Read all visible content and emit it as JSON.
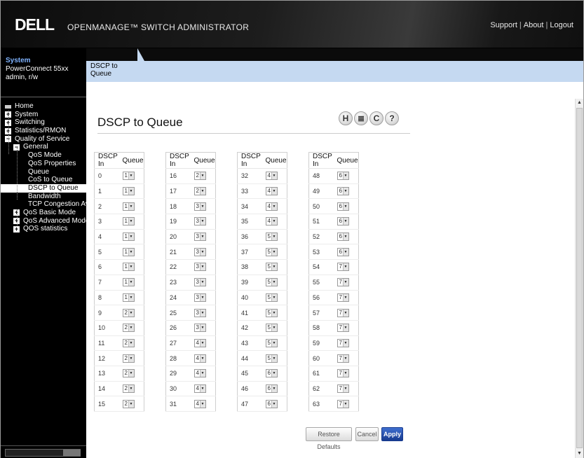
{
  "header": {
    "logo": "DELL",
    "title": "OPENMANAGE™ SWITCH ADMINISTRATOR",
    "links": [
      "Support",
      "About",
      "Logout"
    ]
  },
  "sidebar": {
    "system_title": "System",
    "device": "PowerConnect 55xx",
    "user": "admin, r/w",
    "items": [
      {
        "label": "Home",
        "level": 0,
        "icon": "home-icon"
      },
      {
        "label": "System",
        "level": 0,
        "icon": "expand-icon"
      },
      {
        "label": "Switching",
        "level": 0,
        "icon": "expand-icon"
      },
      {
        "label": "Statistics/RMON",
        "level": 0,
        "icon": "expand-icon"
      },
      {
        "label": "Quality of Service",
        "level": 0,
        "icon": "collapse-icon"
      },
      {
        "label": "General",
        "level": 1,
        "icon": "collapse-icon"
      },
      {
        "label": "QoS Mode",
        "level": 2
      },
      {
        "label": "QoS Properties",
        "level": 2
      },
      {
        "label": "Queue",
        "level": 2
      },
      {
        "label": "CoS to Queue",
        "level": 2
      },
      {
        "label": "DSCP to Queue",
        "level": 2,
        "selected": true
      },
      {
        "label": "Bandwidth",
        "level": 2
      },
      {
        "label": "TCP Congestion Avoi",
        "level": 2
      },
      {
        "label": "QoS Basic Mode",
        "level": 1,
        "icon": "expand-icon"
      },
      {
        "label": "QoS Advanced Mode",
        "level": 1,
        "icon": "expand-icon"
      },
      {
        "label": "QOS statistics",
        "level": 1,
        "icon": "expand-icon"
      }
    ]
  },
  "tab": {
    "label": "DSCP to Queue"
  },
  "page": {
    "title": "DSCP to Queue",
    "tools": [
      {
        "name": "save-icon",
        "glyph": "H"
      },
      {
        "name": "print-icon",
        "glyph": "≣"
      },
      {
        "name": "refresh-icon",
        "glyph": "C"
      },
      {
        "name": "help-icon",
        "glyph": "?"
      }
    ]
  },
  "table": {
    "headers": {
      "dscp": "DSCP In",
      "queue": "Queue"
    },
    "columns": [
      {
        "dscp": [
          "0",
          "1",
          "2",
          "3",
          "4",
          "5",
          "6",
          "7",
          "8",
          "9",
          "10",
          "11",
          "12",
          "13",
          "14",
          "15"
        ],
        "queue": [
          "1",
          "1",
          "1",
          "1",
          "1",
          "1",
          "1",
          "1",
          "1",
          "2",
          "2",
          "2",
          "2",
          "2",
          "2",
          "2"
        ]
      },
      {
        "dscp": [
          "16",
          "17",
          "18",
          "19",
          "20",
          "21",
          "22",
          "23",
          "24",
          "25",
          "26",
          "27",
          "28",
          "29",
          "30",
          "31"
        ],
        "queue": [
          "2",
          "2",
          "3",
          "3",
          "3",
          "3",
          "3",
          "3",
          "3",
          "3",
          "3",
          "4",
          "4",
          "4",
          "4",
          "4"
        ]
      },
      {
        "dscp": [
          "32",
          "33",
          "34",
          "35",
          "36",
          "37",
          "38",
          "39",
          "40",
          "41",
          "42",
          "43",
          "44",
          "45",
          "46",
          "47"
        ],
        "queue": [
          "4",
          "4",
          "4",
          "4",
          "5",
          "5",
          "5",
          "5",
          "5",
          "5",
          "5",
          "5",
          "5",
          "6",
          "6",
          "6"
        ]
      },
      {
        "dscp": [
          "48",
          "49",
          "50",
          "51",
          "52",
          "53",
          "54",
          "55",
          "56",
          "57",
          "58",
          "59",
          "60",
          "61",
          "62",
          "63"
        ],
        "queue": [
          "6",
          "6",
          "6",
          "6",
          "6",
          "6",
          "7",
          "7",
          "7",
          "7",
          "7",
          "7",
          "7",
          "7",
          "7",
          "7"
        ]
      }
    ]
  },
  "buttons": {
    "restore": "Restore Defaults",
    "cancel": "Cancel",
    "apply": "Apply"
  }
}
